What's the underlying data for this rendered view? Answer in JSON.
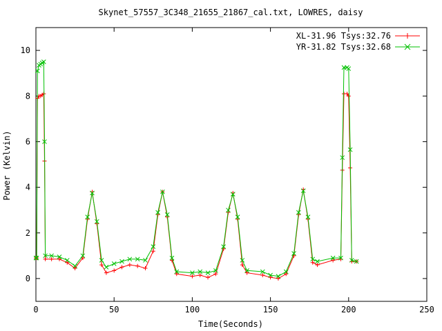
{
  "chart_data": {
    "type": "line",
    "title": "Skynet_57557_3C348_21655_21867_cal.txt, LOWRES, daisy",
    "xlabel": "Time(Seconds)",
    "ylabel": "Power (Kelvin)",
    "xlim": [
      0,
      250
    ],
    "ylim": [
      -1,
      11
    ],
    "xticks": [
      0,
      50,
      100,
      150,
      200,
      250
    ],
    "yticks": [
      0,
      2,
      4,
      6,
      8,
      10
    ],
    "grid": false,
    "legend_position": "top-right",
    "series": [
      {
        "name": "XL-31.96 Tsys:32.76",
        "color": "#ff0000",
        "marker": "plus",
        "points": [
          [
            0.0,
            0.9
          ],
          [
            0.5,
            0.9
          ],
          [
            1.0,
            7.9
          ],
          [
            2.0,
            8.0
          ],
          [
            3.0,
            8.0
          ],
          [
            4.0,
            8.05
          ],
          [
            5.0,
            8.1
          ],
          [
            5.5,
            5.15
          ],
          [
            6.0,
            0.85
          ],
          [
            10,
            0.85
          ],
          [
            15,
            0.85
          ],
          [
            20,
            0.7
          ],
          [
            25,
            0.45
          ],
          [
            30,
            0.9
          ],
          [
            33,
            2.6
          ],
          [
            36,
            3.8
          ],
          [
            39,
            2.4
          ],
          [
            42,
            0.6
          ],
          [
            45,
            0.25
          ],
          [
            50,
            0.35
          ],
          [
            55,
            0.5
          ],
          [
            60,
            0.6
          ],
          [
            65,
            0.55
          ],
          [
            70,
            0.45
          ],
          [
            75,
            1.2
          ],
          [
            78,
            2.8
          ],
          [
            81,
            3.8
          ],
          [
            84,
            2.7
          ],
          [
            87,
            0.8
          ],
          [
            90,
            0.2
          ],
          [
            100,
            0.1
          ],
          [
            105,
            0.15
          ],
          [
            110,
            0.05
          ],
          [
            115,
            0.2
          ],
          [
            120,
            1.3
          ],
          [
            123,
            2.9
          ],
          [
            126,
            3.75
          ],
          [
            129,
            2.6
          ],
          [
            132,
            0.6
          ],
          [
            135,
            0.25
          ],
          [
            145,
            0.15
          ],
          [
            150,
            0.05
          ],
          [
            155,
            0.0
          ],
          [
            160,
            0.2
          ],
          [
            165,
            1.0
          ],
          [
            168,
            2.8
          ],
          [
            171,
            3.9
          ],
          [
            174,
            2.6
          ],
          [
            177,
            0.7
          ],
          [
            180,
            0.6
          ],
          [
            190,
            0.8
          ],
          [
            195,
            0.85
          ],
          [
            196,
            4.75
          ],
          [
            197,
            8.1
          ],
          [
            199,
            8.1
          ],
          [
            200,
            8.0
          ],
          [
            201,
            4.85
          ],
          [
            202,
            0.75
          ],
          [
            205,
            0.75
          ]
        ]
      },
      {
        "name": "YR-31.82 Tsys:32.68",
        "color": "#00c000",
        "marker": "cross",
        "points": [
          [
            0.0,
            0.9
          ],
          [
            0.5,
            0.9
          ],
          [
            1.0,
            9.1
          ],
          [
            2.0,
            9.35
          ],
          [
            3.0,
            9.4
          ],
          [
            4.0,
            9.45
          ],
          [
            5.0,
            9.5
          ],
          [
            5.5,
            6.0
          ],
          [
            6.0,
            1.0
          ],
          [
            10,
            1.0
          ],
          [
            15,
            0.95
          ],
          [
            20,
            0.8
          ],
          [
            25,
            0.55
          ],
          [
            30,
            1.0
          ],
          [
            33,
            2.7
          ],
          [
            36,
            3.75
          ],
          [
            39,
            2.5
          ],
          [
            42,
            0.8
          ],
          [
            45,
            0.5
          ],
          [
            50,
            0.65
          ],
          [
            55,
            0.75
          ],
          [
            60,
            0.85
          ],
          [
            65,
            0.85
          ],
          [
            70,
            0.8
          ],
          [
            75,
            1.4
          ],
          [
            78,
            2.9
          ],
          [
            81,
            3.8
          ],
          [
            84,
            2.8
          ],
          [
            87,
            0.9
          ],
          [
            90,
            0.3
          ],
          [
            100,
            0.25
          ],
          [
            105,
            0.3
          ],
          [
            110,
            0.25
          ],
          [
            115,
            0.35
          ],
          [
            120,
            1.4
          ],
          [
            123,
            3.0
          ],
          [
            126,
            3.7
          ],
          [
            129,
            2.7
          ],
          [
            132,
            0.8
          ],
          [
            135,
            0.35
          ],
          [
            145,
            0.3
          ],
          [
            150,
            0.15
          ],
          [
            155,
            0.1
          ],
          [
            160,
            0.3
          ],
          [
            165,
            1.1
          ],
          [
            168,
            2.9
          ],
          [
            171,
            3.85
          ],
          [
            174,
            2.7
          ],
          [
            177,
            0.85
          ],
          [
            180,
            0.75
          ],
          [
            190,
            0.9
          ],
          [
            195,
            0.9
          ],
          [
            196,
            5.3
          ],
          [
            197,
            9.25
          ],
          [
            199,
            9.25
          ],
          [
            200,
            9.2
          ],
          [
            201,
            5.65
          ],
          [
            202,
            0.8
          ],
          [
            205,
            0.75
          ]
        ]
      }
    ]
  }
}
